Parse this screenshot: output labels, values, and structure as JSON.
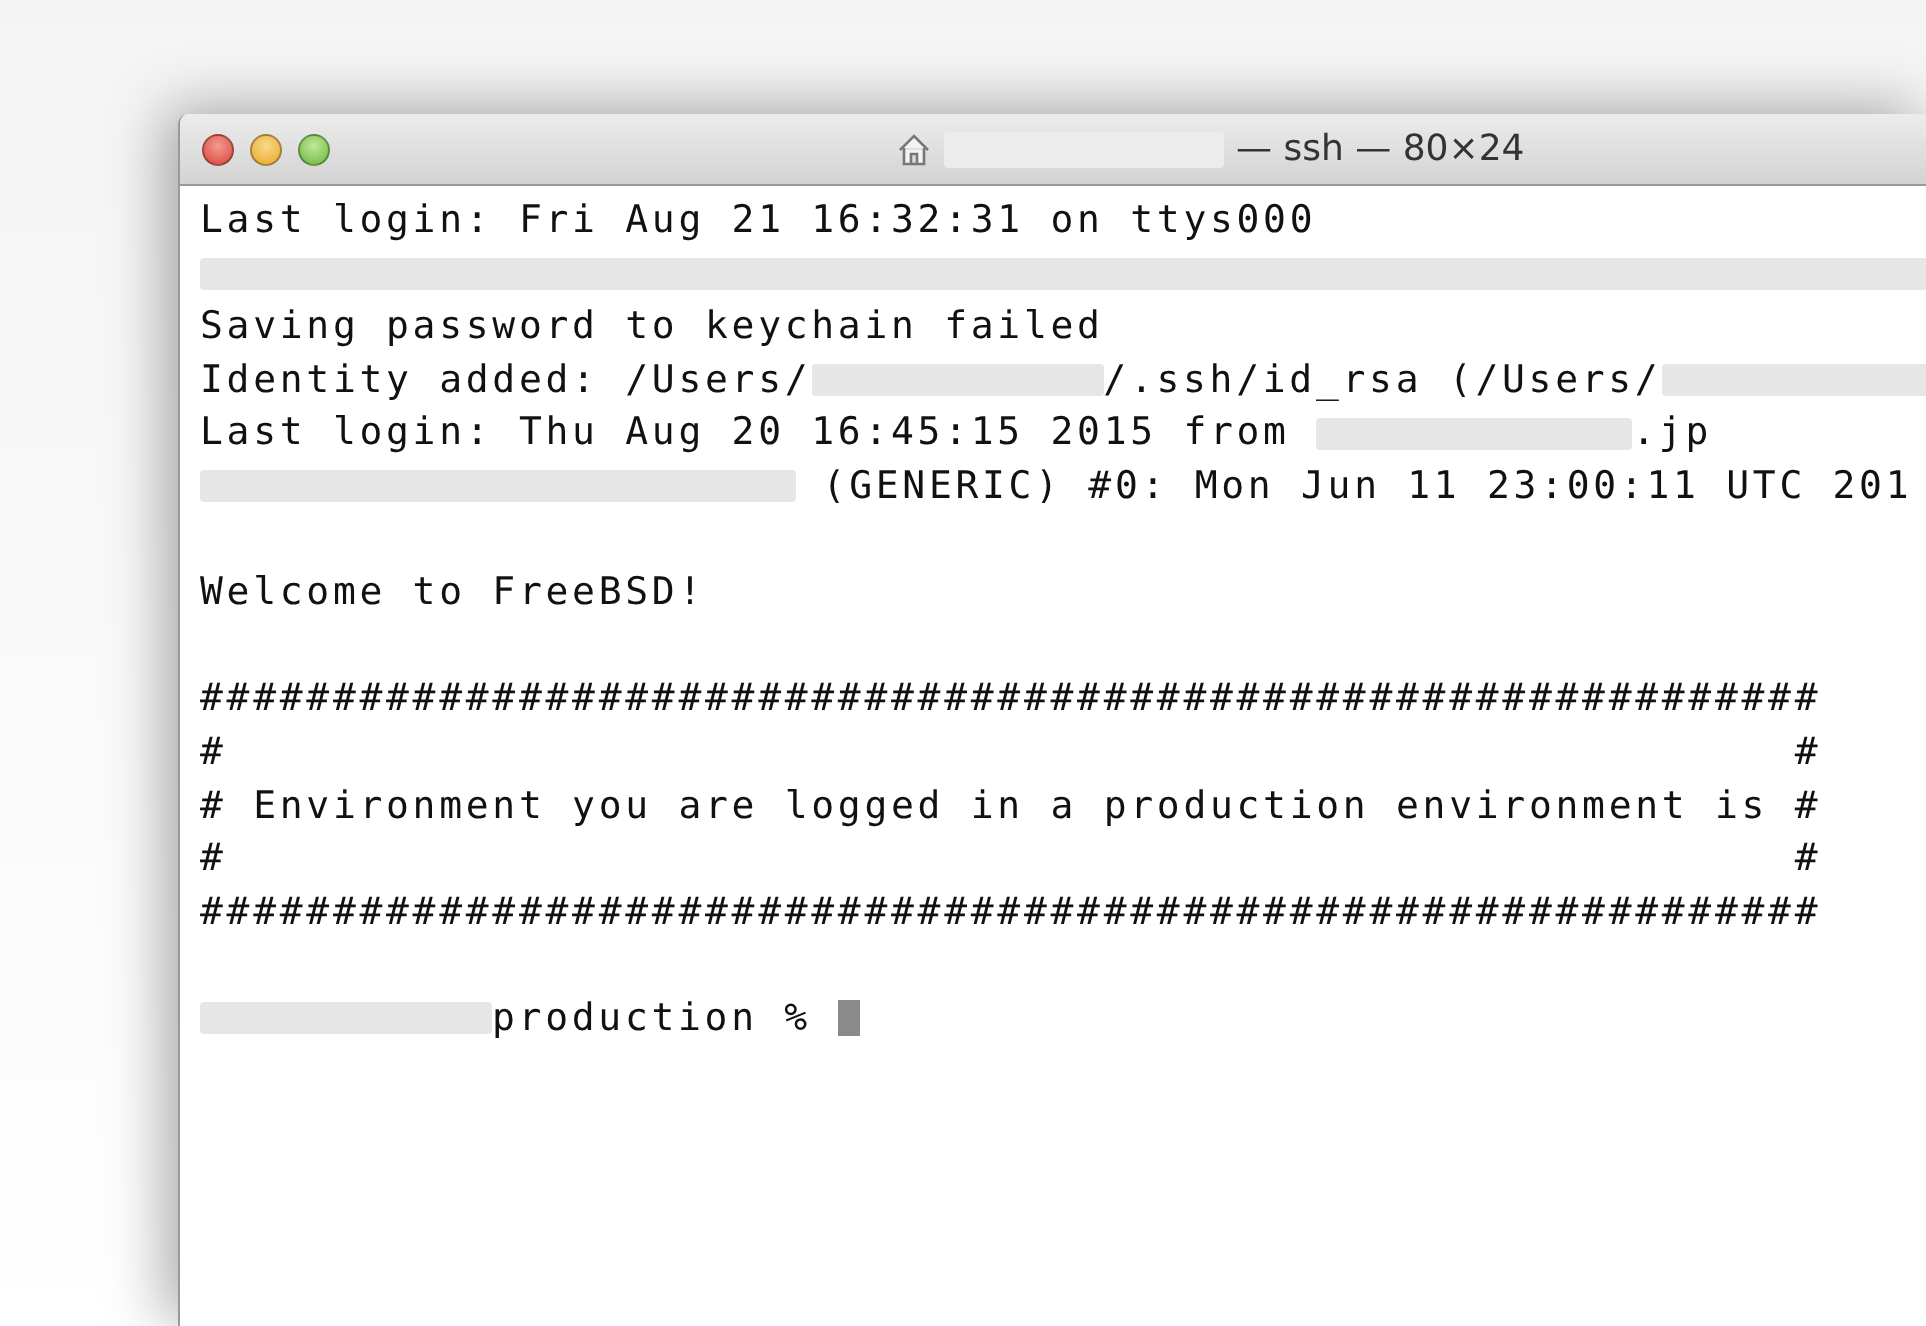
{
  "window": {
    "title": "— ssh — 80×24"
  },
  "terminal": {
    "lines": [
      {
        "segments": [
          {
            "kind": "text",
            "text": "Last login: Fri Aug 21 16:32:31 on ttys000"
          }
        ]
      },
      {
        "segments": [
          {
            "kind": "fillmask"
          }
        ]
      },
      {
        "segments": [
          {
            "kind": "text",
            "text": "Saving password to keychain failed"
          }
        ]
      },
      {
        "segments": [
          {
            "kind": "text",
            "text": "Identity added: /Users/"
          },
          {
            "kind": "shortmask"
          },
          {
            "kind": "text",
            "text": "/.ssh/id_rsa (/Users/"
          },
          {
            "kind": "fillmask"
          }
        ]
      },
      {
        "segments": [
          {
            "kind": "text",
            "text": "Last login: Thu Aug 20 16:45:15 2015 from "
          },
          {
            "kind": "mediummask"
          },
          {
            "kind": "text",
            "text": ".jp"
          }
        ]
      },
      {
        "segments": [
          {
            "kind": "longmask"
          },
          {
            "kind": "text",
            "text": " (GENERIC) #0: Mon Jun 11 23:00:11 UTC 201"
          }
        ]
      },
      {
        "kind": "blank"
      },
      {
        "segments": [
          {
            "kind": "text",
            "text": "Welcome to FreeBSD!"
          }
        ]
      },
      {
        "kind": "blank"
      },
      {
        "segments": [
          {
            "kind": "text",
            "text": "#############################################################"
          }
        ]
      },
      {
        "segments": [
          {
            "kind": "text",
            "text": "#                                                           #"
          }
        ]
      },
      {
        "segments": [
          {
            "kind": "text",
            "text": "# Environment you are logged in a production environment is #"
          }
        ]
      },
      {
        "segments": [
          {
            "kind": "text",
            "text": "#                                                           #"
          }
        ]
      },
      {
        "segments": [
          {
            "kind": "text",
            "text": "#############################################################"
          }
        ]
      },
      {
        "kind": "blank"
      },
      {
        "segments": [
          {
            "kind": "shortmask"
          },
          {
            "kind": "text",
            "text": "production % "
          },
          {
            "kind": "cursor"
          }
        ]
      }
    ]
  }
}
